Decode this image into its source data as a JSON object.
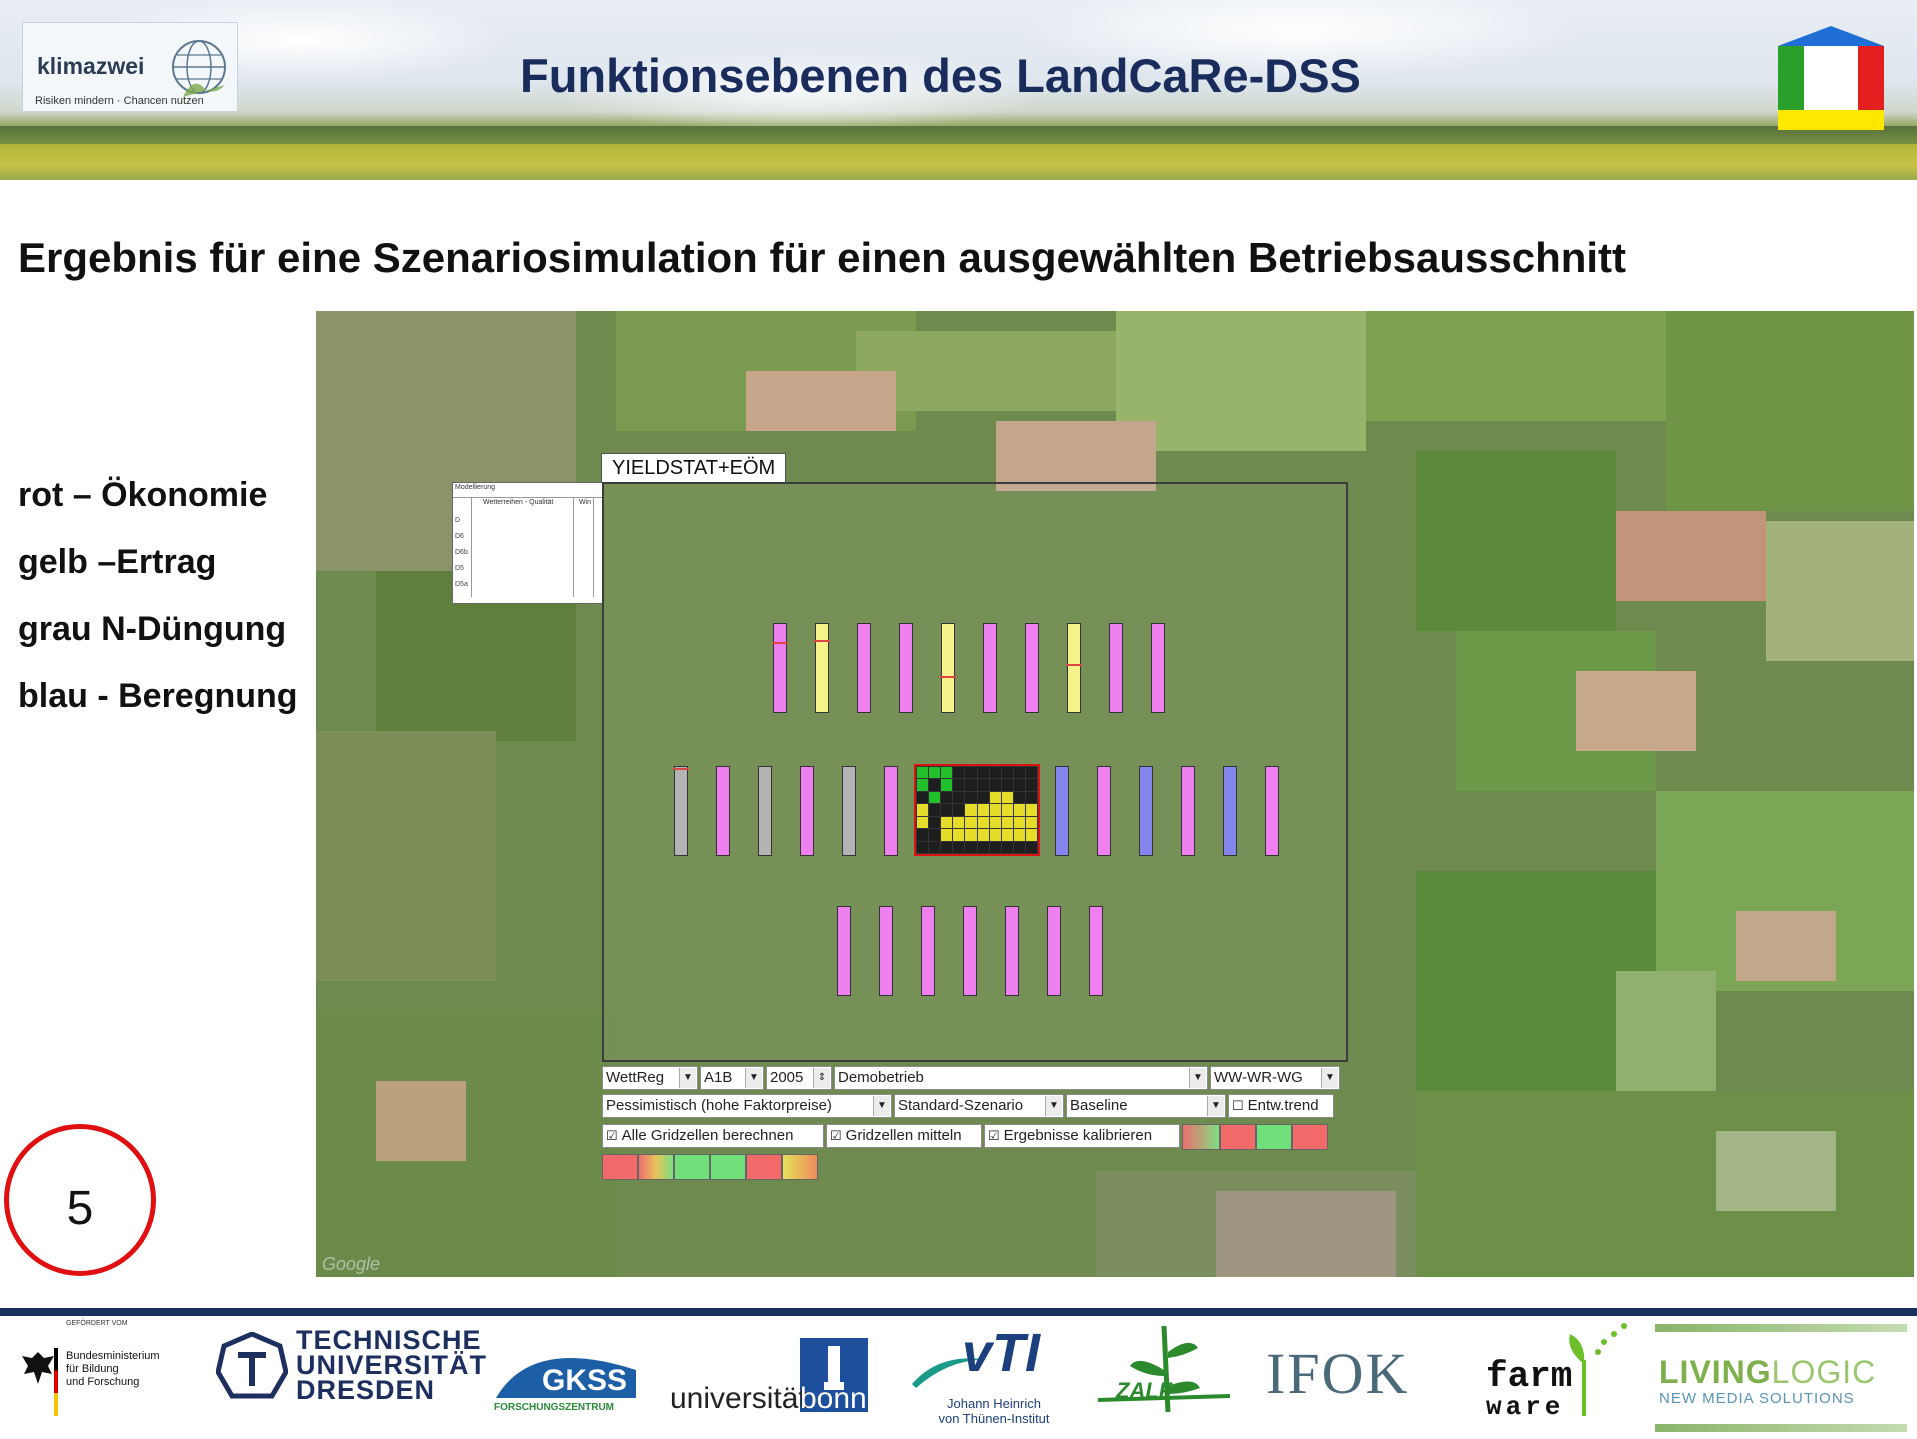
{
  "header": {
    "title": "Funktionsebenen des LandCaRe-DSS",
    "logo_name": "klimazwei",
    "logo_tagline": "Risiken mindern · Chancen nutzen"
  },
  "subtitle": "Ergebnis für eine Szenariosimulation für einen ausgewählten Betriebsausschnitt",
  "legend": [
    "rot – Ökonomie",
    "gelb –Ertrag",
    "grau N-Düngung",
    "blau - Beregnung"
  ],
  "slide_number": "5",
  "map": {
    "attribution": "Google",
    "panel_label": "YIELDSTAT+EÖM",
    "mini_table": {
      "title": "Modellierung",
      "col1": "Wetterreihen - Qualität",
      "col2": "Win",
      "rows": [
        "D",
        "D6",
        "D6b",
        "D5",
        "D5a"
      ]
    }
  },
  "controls": {
    "row1": {
      "model": "WettReg",
      "scenario": "A1B",
      "year": "2005",
      "farm": "Demobetrieb",
      "rotation": "WW-WR-WG"
    },
    "row2": {
      "price": "Pessimistisch (hohe Faktorpreise)",
      "standard": "Standard-Szenario",
      "baseline": "Baseline",
      "trend_label": "Entw.trend"
    },
    "row3": {
      "all_gridcells": "Alle Gridzellen berechnen",
      "average_gridcells": "Gridzellen mitteln",
      "calibrate": "Ergebnisse kalibrieren"
    }
  },
  "colors": {
    "economy": "#ee7fee",
    "yield": "#f6f28c",
    "fertilizer": "#b4b4b4",
    "irrigation": "#8585ee",
    "accent_red": "#e01010",
    "title_blue": "#1a2c5c"
  },
  "sponsors": {
    "bmbf_top": "GEFÖRDERT VOM",
    "bmbf_1": "Bundesministerium",
    "bmbf_2": "für Bildung",
    "bmbf_3": "und Forschung",
    "tud_1": "TECHNISCHE",
    "tud_2": "UNIVERSITÄT",
    "tud_3": "DRESDEN",
    "gkss": "GKSS",
    "gkss_sub": "FORSCHUNGSZENTRUM",
    "bonn_a": "universität",
    "bonn_b": "bonn",
    "vti": "vTI",
    "vti_sub1": "Johann Heinrich",
    "vti_sub2": "von Thünen-Institut",
    "zalf": "ZALF",
    "ifok": "IFOK",
    "farm": "farm",
    "ware": "ware",
    "living": "LIVING",
    "logic": "LOGIC",
    "living_sub": "NEW MEDIA SOLUTIONS"
  }
}
